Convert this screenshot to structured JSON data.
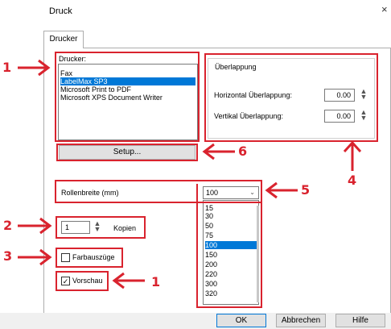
{
  "window": {
    "title": "Druck",
    "close_glyph": "×"
  },
  "tabs": [
    {
      "label": "Drucker"
    }
  ],
  "printer_group": {
    "label": "Drucker:",
    "items": [
      "Fax",
      "LabelMax SP3",
      "Microsoft Print to PDF",
      "Microsoft XPS Document Writer"
    ],
    "selected_index": 1
  },
  "setup_button": {
    "label": "Setup..."
  },
  "overlap_group": {
    "label": "Überlappung",
    "horizontal_label": "Horizontal Überlappung:",
    "horizontal_value": "0.00",
    "vertical_label": "Vertikal Überlappung:",
    "vertical_value": "0.00"
  },
  "roll_width": {
    "label": "Rollenbreite (mm)",
    "selected": "100",
    "options": [
      "15",
      "30",
      "50",
      "75",
      "100",
      "150",
      "200",
      "220",
      "300",
      "320"
    ],
    "selected_index": 4
  },
  "copies": {
    "value": "1",
    "label": "Kopien"
  },
  "color_separation": {
    "label": "Farbauszüge",
    "checked": false
  },
  "preview": {
    "label": "Vorschau",
    "checked": true
  },
  "footer_buttons": {
    "ok": "OK",
    "cancel": "Abbrechen",
    "help": "Hilfe"
  },
  "annotations": {
    "a1": "1",
    "a2": "2",
    "a3": "3",
    "a4": "4",
    "a5": "5",
    "a6": "6",
    "a1b": "1",
    "color": "#d9232e"
  },
  "colors": {
    "selection": "#0078d7",
    "annotation": "#d9232e"
  }
}
